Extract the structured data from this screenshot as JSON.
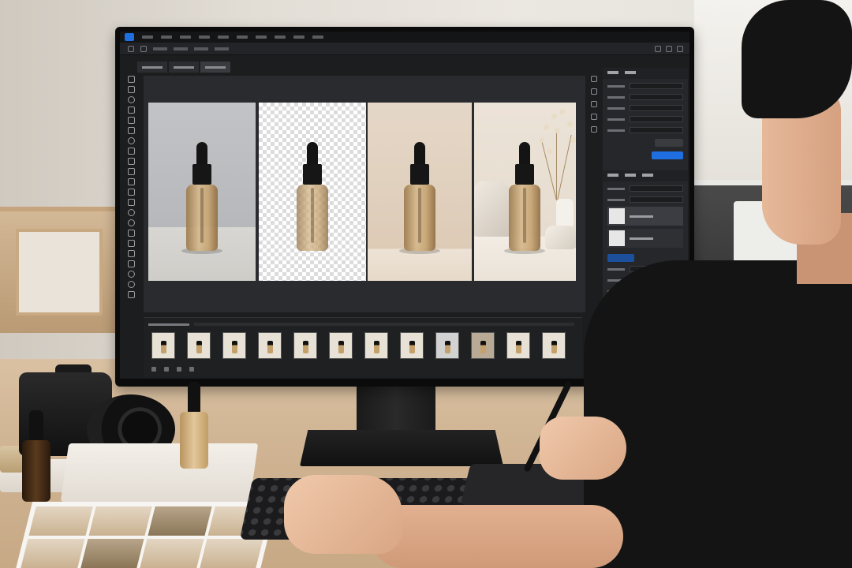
{
  "scene": {
    "description_colors": {
      "accent": "#1f6fe3",
      "bottle_amber": "#c7a573",
      "ui_background": "#1c1d1f"
    }
  },
  "app": {
    "menu_items": [
      "",
      "",
      "",
      "",
      "",
      "",
      "",
      "",
      "",
      ""
    ],
    "doc_tabs": [
      {
        "active": false
      },
      {
        "active": false
      },
      {
        "active": true
      }
    ],
    "canvas_panels": [
      "grey-backdrop-bottle",
      "transparent-background-bottle",
      "beige-backdrop-bottle",
      "styled-scene-bottle"
    ],
    "filmstrip": {
      "thumbnails": [
        "light",
        "light",
        "light",
        "light",
        "light",
        "light",
        "light",
        "light",
        "grey",
        "dark",
        "light",
        "light"
      ]
    },
    "right_panel": {
      "primary_button_color": "#1f6fe3",
      "layers": [
        {
          "selected": true
        },
        {
          "selected": false
        }
      ]
    }
  },
  "desk": {
    "items": [
      "camera",
      "dropper-bottle",
      "amber-bottle",
      "keyboard",
      "pen-tablet",
      "stylus",
      "photo-contact-sheet"
    ]
  }
}
